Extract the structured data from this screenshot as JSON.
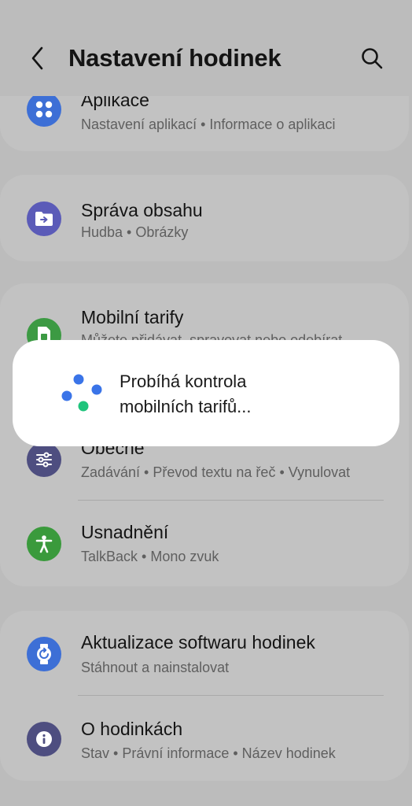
{
  "header": {
    "title": "Nastavení hodinek",
    "back_icon": "chevron-left-icon",
    "search_icon": "search-icon"
  },
  "items": [
    {
      "title": "Aplikace",
      "subtitle": "Nastavení aplikací • Informace o aplikaci",
      "icon": "apps-grid-icon",
      "icon_color": "#3d6fd6"
    },
    {
      "title": "Správa obsahu",
      "subtitle": "Hudba • Obrázky",
      "icon": "content-transfer-icon",
      "icon_color": "#5b5bb8"
    },
    {
      "title": "Mobilní tarify",
      "subtitle": "Můžete přidávat, spravovat nebo odebírat",
      "icon": "sim-card-icon",
      "icon_color": "#3c9a43"
    },
    {
      "title": "Obecné",
      "subtitle": "Zadávání • Převod textu na řeč • Vynulovat",
      "icon": "sliders-icon",
      "icon_color": "#4e4e80"
    },
    {
      "title": "Usnadnění",
      "subtitle": "TalkBack • Mono zvuk",
      "icon": "accessibility-icon",
      "icon_color": "#3a9a3c"
    },
    {
      "title": "Aktualizace softwaru hodinek",
      "subtitle": "Stáhnout a nainstalovat",
      "icon": "watch-update-icon",
      "icon_color": "#3d6fd6"
    },
    {
      "title": "O hodinkách",
      "subtitle": "Stav • Právní informace • Název hodinek",
      "icon": "info-icon",
      "icon_color": "#4e4e80"
    }
  ],
  "dialog": {
    "line1": "Probíhá kontrola",
    "line2": "mobilních tarifů..."
  },
  "colors": {
    "background_dim": "#bcbcbc",
    "card": "#c2c2c2",
    "spinner_blue": "#3a74e8",
    "spinner_green": "#1fc47c"
  }
}
